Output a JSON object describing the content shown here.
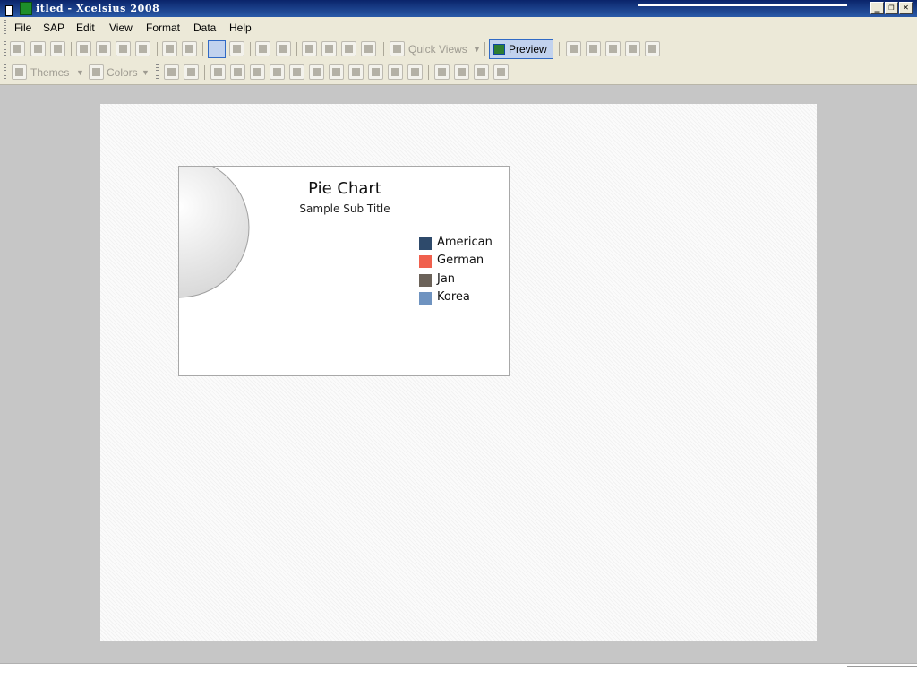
{
  "window": {
    "title": "itled - Xcelsius 2008",
    "controls": {
      "minimize": "_",
      "restore": "❐",
      "close": "✕"
    }
  },
  "menu": {
    "items": [
      "File",
      "SAP",
      "Edit",
      "View",
      "Format",
      "Data",
      "Help"
    ]
  },
  "toolbar1": {
    "quick_views_label": "Quick Views",
    "preview_label": "Preview"
  },
  "toolbar2": {
    "themes_label": "Themes",
    "colors_label": "Colors"
  },
  "chart": {
    "title": "Pie Chart",
    "subtitle": "Sample Sub Title",
    "legend": [
      {
        "label": "American",
        "color": "#2e4a6b"
      },
      {
        "label": "German",
        "color": "#f0604d"
      },
      {
        "label": "Jan",
        "color": "#6b6259"
      },
      {
        "label": "Korea",
        "color": "#6f93c0"
      }
    ]
  },
  "chart_data": {
    "type": "pie",
    "title": "Pie Chart",
    "subtitle": "Sample Sub Title",
    "legend_position": "right",
    "categories": [
      "American",
      "German",
      "Jan",
      "Korea"
    ],
    "values": []
  }
}
